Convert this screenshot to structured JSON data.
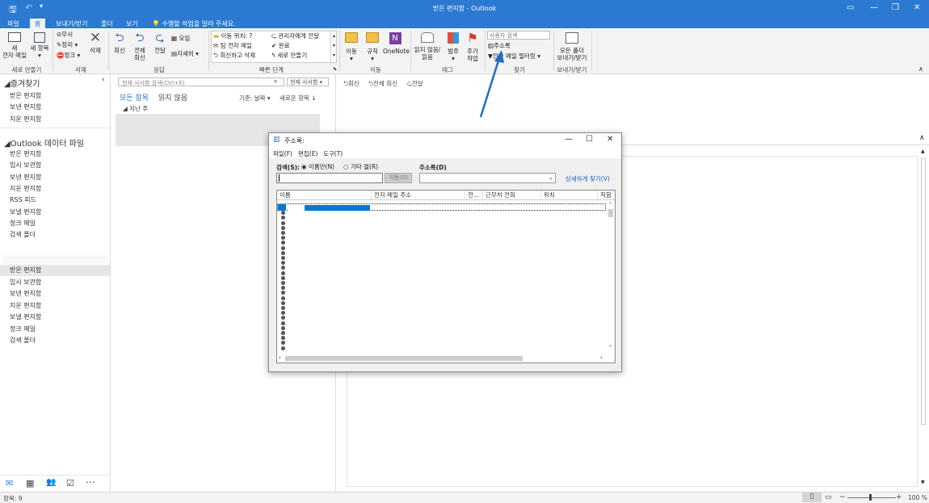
{
  "window": {
    "title": "받은 편지함 - ",
    "app": "Outlook"
  },
  "tabs": [
    {
      "label": "파일"
    },
    {
      "label": "홈"
    },
    {
      "label": "보내기/받기"
    },
    {
      "label": "폴더"
    },
    {
      "label": "보기"
    }
  ],
  "tell_me": "수행할 작업을 알려 주세요.",
  "ribbon": {
    "new_email": "새\n전자 메일",
    "new_items": "새 항목",
    "group_new": "새로 만들기",
    "ignore": "무시",
    "cleanup": "정리",
    "junk": "정크",
    "delete": "삭제",
    "group_delete": "삭제",
    "reply": "회신",
    "reply_all": "전체\n회신",
    "forward": "전달",
    "meeting": "모임",
    "more": "자세히",
    "group_respond": "응답",
    "quicksteps": [
      "이동 위치: ?",
      "팀 전자 메일",
      "회신하고 삭제",
      "관리자에게 전달",
      "완료",
      "새로 만들기"
    ],
    "group_quicksteps": "빠른 단계",
    "move": "이동",
    "rules": "규칙",
    "onenote": "OneNote",
    "group_move": "이동",
    "unread_read": "읽지 않음/\n읽음",
    "categorize": "범주",
    "followup": "추가\n작업",
    "group_tags": "태그",
    "search_people_placeholder": "사용자 검색",
    "address_book": "주소록",
    "filter_email": "전자 메일 필터링",
    "group_find": "찾기",
    "sendreceive_all": "모든 폴더\n보내기/받기",
    "group_sendreceive": "보내기/받기"
  },
  "folders": {
    "favorites_header": "즐겨찾기",
    "favorites": [
      "받은 편지함",
      "보낸 편지함",
      "지운 편지함"
    ],
    "datafile_header": "Outlook 데이터 파일",
    "datafile_items": [
      "받은 편지함",
      "임시 보관함",
      "보낸 편지함",
      "지운 편지함",
      "RSS 피드",
      "보낼 편지함",
      "정크 메일",
      "검색 폴더"
    ],
    "account_items": [
      "받은 편지함",
      "임시 보관함",
      "보낸 편지함",
      "지운 편지함",
      "보낼 편지함",
      "정크 메일",
      "검색 폴더"
    ]
  },
  "maillist": {
    "search_placeholder": "현재 사서함 검색(Ctrl+E)",
    "scope": "현재 사서함",
    "tab_all": "모든 항목",
    "tab_unread": "읽지 않음",
    "sort_by": "기준: 날짜",
    "sort_order": "새로운 항목",
    "group_header": "지난 주"
  },
  "reading": {
    "reply": "회신",
    "reply_all": "전체 회신",
    "forward": "전달"
  },
  "dialog": {
    "title": "주소록:",
    "menu": [
      "파일(F)",
      "편집(E)",
      "도구(T)"
    ],
    "search_label": "검색(S):",
    "radio_name": "이름만(N)",
    "radio_more": "기타 열(R)",
    "addressbook_label": "주소록(D)",
    "go_button": "이동(G)",
    "advanced_link": "상세하게 찾기(V)",
    "columns": [
      "이름",
      "전자 메일 주소",
      "전...",
      "근무처 전화",
      "위치",
      "직함"
    ],
    "row_count": 29
  },
  "status": {
    "items": "항목: 9",
    "zoom": "100 %"
  },
  "colors": {
    "accent": "#2b79d0",
    "selection": "#0078d7",
    "arrow": "#1f6fbf"
  }
}
